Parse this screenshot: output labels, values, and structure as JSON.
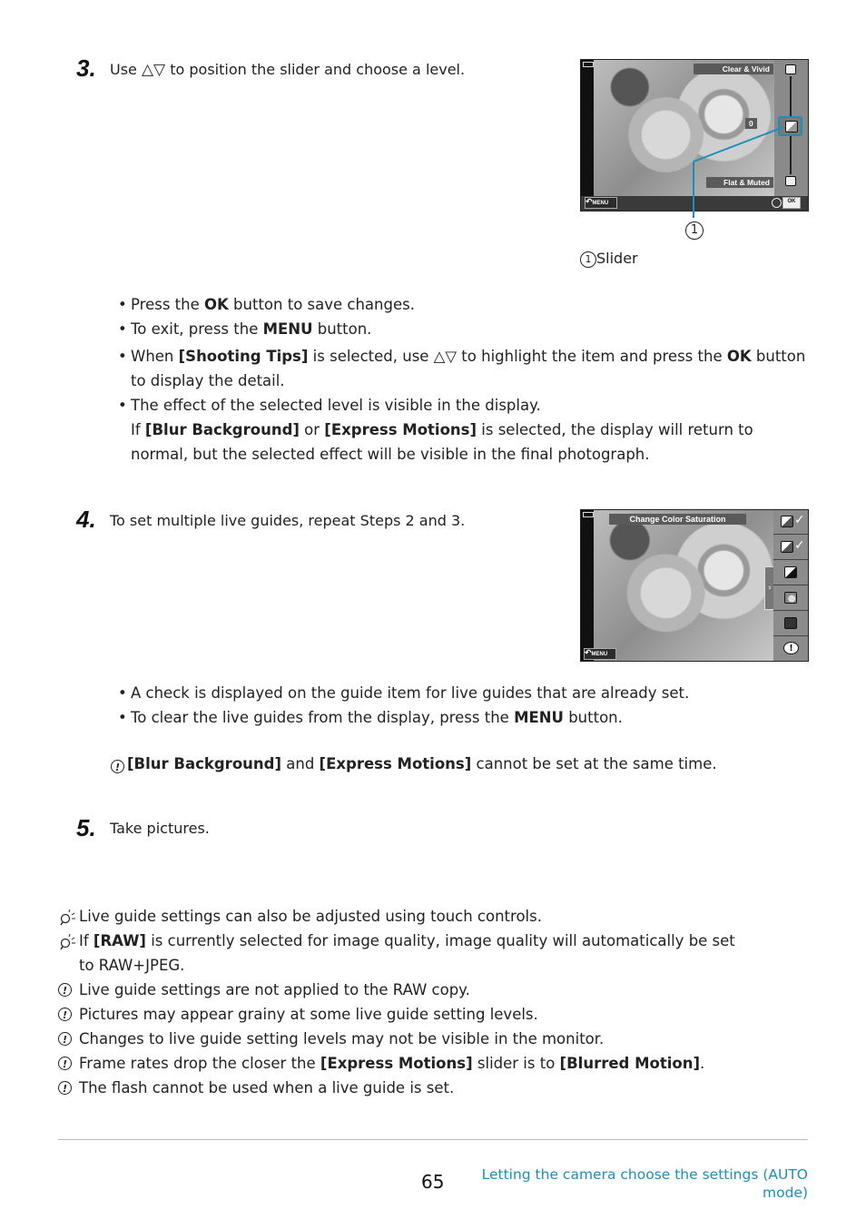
{
  "step3": {
    "number": "3.",
    "text_before": "Use",
    "arrows": "△▽",
    "text_after": "to position the slider and choose a level.",
    "screen": {
      "top_label": "Clear & Vivid",
      "bottom_label": "Flat & Muted",
      "value": "0",
      "back_button": "MENU",
      "ok_button": "OK",
      "callout_number": "1",
      "slider_level": 0
    },
    "caption_number": "1",
    "caption_text": "Slider",
    "bullets": [
      {
        "parts": [
          {
            "t": "Press the "
          },
          {
            "b": "OK"
          },
          {
            "t": " button to save changes."
          }
        ]
      },
      {
        "parts": [
          {
            "t": "To exit, press the "
          },
          {
            "b": "MENU"
          },
          {
            "t": " button."
          }
        ]
      },
      {
        "parts": [
          {
            "t": "When "
          },
          {
            "b": "[Shooting Tips]"
          },
          {
            "t": " is selected, use △▽ to highlight the item and press the "
          },
          {
            "b": "OK"
          },
          {
            "t": " button to display the detail."
          }
        ]
      },
      {
        "parts": [
          {
            "t": "The effect of the selected level is visible in the display."
          }
        ]
      }
    ],
    "continuation": {
      "parts": [
        {
          "t": "If "
        },
        {
          "b": "[Blur Background]"
        },
        {
          "t": " or "
        },
        {
          "b": "[Express Motions]"
        },
        {
          "t": " is selected, the display will return to normal, but the selected effect will be visible in the final photograph."
        }
      ]
    }
  },
  "step4": {
    "number": "4.",
    "text": "To set multiple live guides, repeat Steps 2 and 3.",
    "screen": {
      "title_label": "Change Color Saturation",
      "back_button": "MENU",
      "guide_items": [
        {
          "icon": "color-saturation-icon",
          "checked": true
        },
        {
          "icon": "color-tone-icon",
          "checked": true
        },
        {
          "icon": "brightness-icon",
          "checked": false
        },
        {
          "icon": "blur-background-icon",
          "checked": false
        },
        {
          "icon": "express-motions-icon",
          "checked": false
        },
        {
          "icon": "shooting-tips-icon",
          "checked": false
        }
      ]
    },
    "bullets": [
      {
        "parts": [
          {
            "t": "A check is displayed on the guide item for live guides that are already set."
          }
        ]
      },
      {
        "parts": [
          {
            "t": "To clear the live guides from the display, press the "
          },
          {
            "b": "MENU"
          },
          {
            "t": " button."
          }
        ]
      }
    ],
    "note": {
      "parts": [
        {
          "b": "[Blur Background]"
        },
        {
          "t": " and "
        },
        {
          "b": "[Express Motions]"
        },
        {
          "t": " cannot be set at the same time."
        }
      ]
    }
  },
  "step5": {
    "number": "5.",
    "text": "Take pictures."
  },
  "notes": [
    {
      "type": "tip",
      "parts": [
        {
          "t": "Live guide settings can also be adjusted using touch controls."
        }
      ]
    },
    {
      "type": "tip",
      "parts": [
        {
          "t": "If "
        },
        {
          "b": "[RAW]"
        },
        {
          "t": " is currently selected for image quality, image quality will automatically be set to RAW+JPEG."
        }
      ]
    },
    {
      "type": "caution",
      "parts": [
        {
          "t": "Live guide settings are not applied to the RAW copy."
        }
      ]
    },
    {
      "type": "caution",
      "parts": [
        {
          "t": "Pictures may appear grainy at some live guide setting levels."
        }
      ]
    },
    {
      "type": "caution",
      "parts": [
        {
          "t": "Changes to live guide setting levels may not be visible in the monitor."
        }
      ]
    },
    {
      "type": "caution",
      "parts": [
        {
          "t": "Frame rates drop the closer the "
        },
        {
          "b": "[Express Motions]"
        },
        {
          "t": " slider is to "
        },
        {
          "b": "[Blurred Motion]"
        },
        {
          "t": "."
        }
      ]
    },
    {
      "type": "caution",
      "parts": [
        {
          "t": "The flash cannot be used when a live guide is set."
        }
      ]
    }
  ],
  "footer": {
    "page_number": "65",
    "section_link": "Letting the camera choose the settings (AUTO mode)",
    "link_color": "#1b8fb8"
  }
}
